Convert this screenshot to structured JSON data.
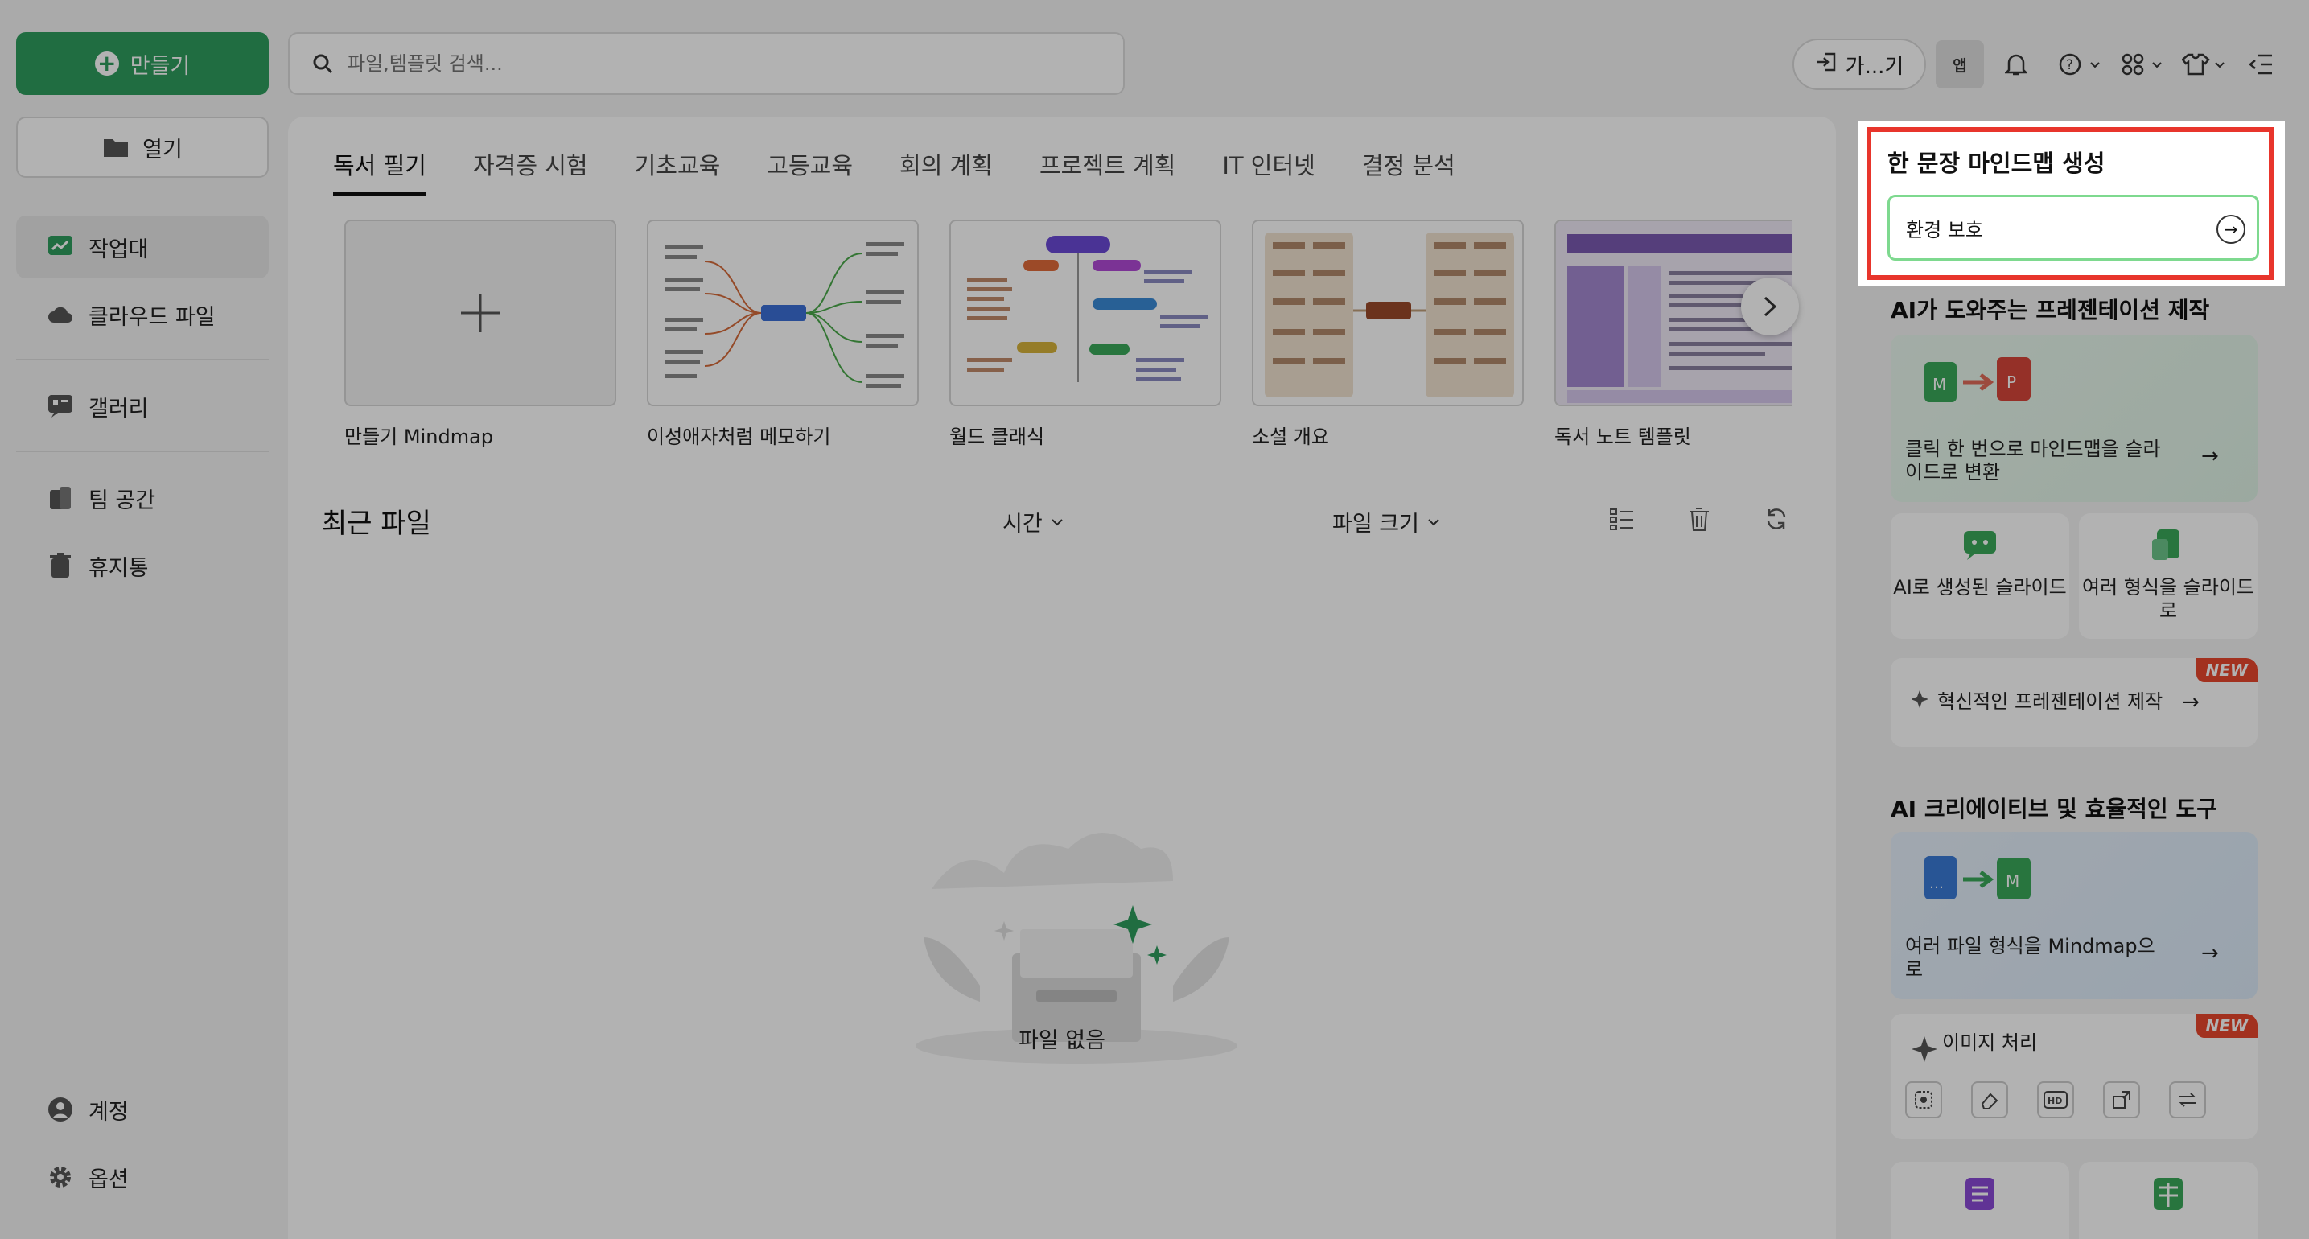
{
  "sidebar": {
    "create_label": "만들기",
    "open_label": "열기",
    "items": [
      {
        "label": "작업대"
      },
      {
        "label": "클라우드 파일"
      },
      {
        "label": "갤러리"
      },
      {
        "label": "팀 공간"
      },
      {
        "label": "휴지통"
      }
    ],
    "bottom": [
      {
        "label": "계정"
      },
      {
        "label": "옵션"
      }
    ]
  },
  "topbar": {
    "search_placeholder": "파일,템플릿 검색...",
    "go_label": "가...기",
    "app_label": "앱"
  },
  "main": {
    "tabs": [
      {
        "label": "독서 필기"
      },
      {
        "label": "자격증 시험"
      },
      {
        "label": "기초교육"
      },
      {
        "label": "고등교육"
      },
      {
        "label": "회의 계획"
      },
      {
        "label": "프로젝트 계획"
      },
      {
        "label": "IT 인터넷"
      },
      {
        "label": "결정 분석"
      }
    ],
    "templates": [
      {
        "label": "만들기 Mindmap"
      },
      {
        "label": "이성애자처럼 메모하기"
      },
      {
        "label": "월드 클래식"
      },
      {
        "label": "소설 개요"
      },
      {
        "label": "독서 노트 템플릿"
      }
    ],
    "recent_title": "최근 파일",
    "sort_time": "시간",
    "sort_size": "파일 크기",
    "empty_text": "파일 없음"
  },
  "right": {
    "mindmap_title": "한 문장 마인드맵 생성",
    "mindmap_input": "환경 보호",
    "ppt_section": "AI가 도와주는 프레젠테이션 제작",
    "ppt_card1": "클릭 한 번으로 마인드맵을 슬라이드로 변환",
    "ppt_card2": "AI로 생성된 슬라이드",
    "ppt_card3": "여러 형식을 슬라이드로",
    "ppt_card4": "혁신적인 프레젠테이션 제작",
    "tools_section": "AI 크리에이티브 및 효율적인 도구",
    "tool_card1": "여러 파일 형식을 Mindmap으로",
    "tool_card2": "이미지 처리",
    "new_badge": "NEW"
  },
  "colors": {
    "accent": "#2e9d5e",
    "highlight": "#e8352c",
    "badge": "#e8472d"
  }
}
